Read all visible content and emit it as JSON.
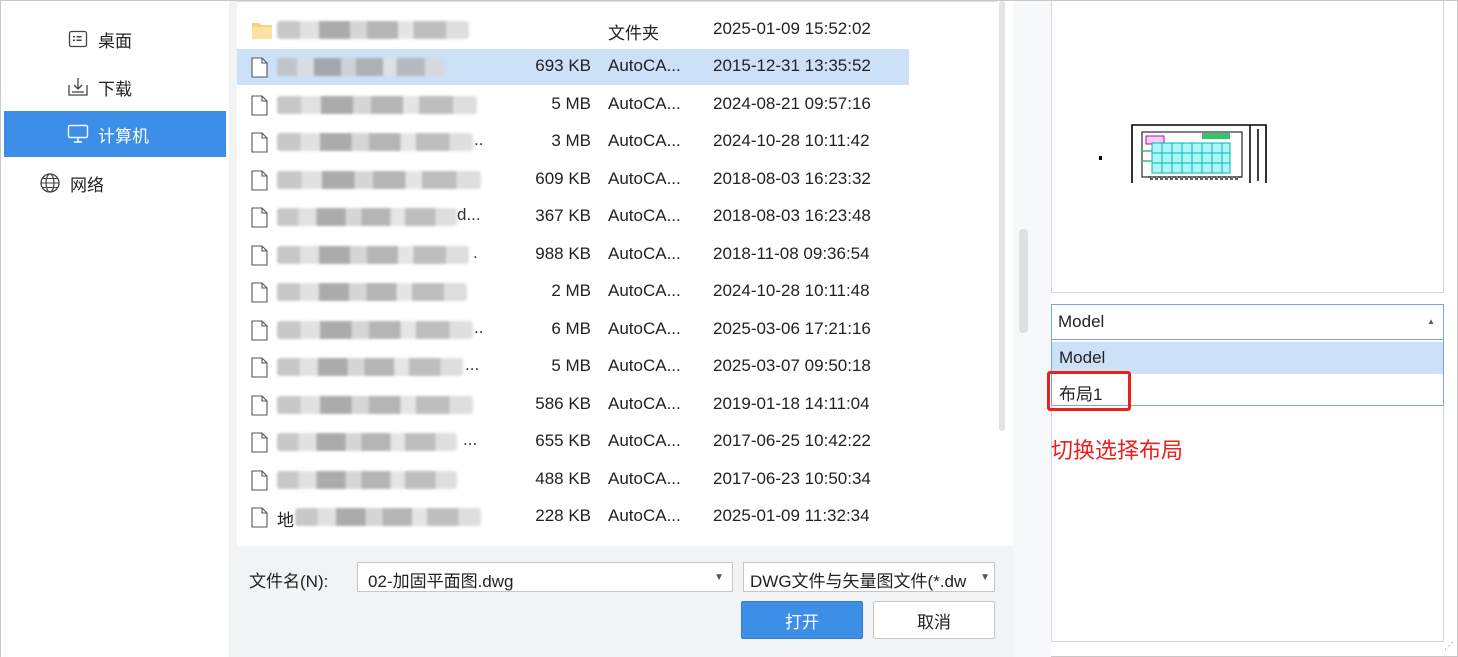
{
  "sidebar": {
    "items": [
      {
        "label": "桌面",
        "icon": "desktop-icon",
        "selected": false
      },
      {
        "label": "下载",
        "icon": "download-icon",
        "selected": false
      },
      {
        "label": "计算机",
        "icon": "computer-icon",
        "selected": true
      },
      {
        "label": "网络",
        "icon": "network-icon",
        "selected": false
      }
    ]
  },
  "files": [
    {
      "name_prefix": "",
      "ellipsis": "",
      "size": "",
      "type": "文件夹",
      "date": "2025-01-09 15:52:02",
      "icon": "folder-icon",
      "selected": false
    },
    {
      "name_prefix": "",
      "ellipsis": "",
      "size": "693 KB",
      "type": "AutoCA...",
      "date": "2015-12-31 13:35:52",
      "icon": "file-icon",
      "selected": true
    },
    {
      "name_prefix": "",
      "ellipsis": "",
      "size": "5 MB",
      "type": "AutoCA...",
      "date": "2024-08-21 09:57:16",
      "icon": "file-icon",
      "selected": false
    },
    {
      "name_prefix": "",
      "ellipsis": "..",
      "size": "3 MB",
      "type": "AutoCA...",
      "date": "2024-10-28 10:11:42",
      "icon": "file-icon",
      "selected": false
    },
    {
      "name_prefix": "",
      "ellipsis": "",
      "size": "609 KB",
      "type": "AutoCA...",
      "date": "2018-08-03 16:23:32",
      "icon": "file-icon",
      "selected": false
    },
    {
      "name_prefix": "",
      "ellipsis": "d...",
      "size": "367 KB",
      "type": "AutoCA...",
      "date": "2018-08-03 16:23:48",
      "icon": "file-icon",
      "selected": false
    },
    {
      "name_prefix": "",
      "ellipsis": ".",
      "size": "988 KB",
      "type": "AutoCA...",
      "date": "2018-11-08 09:36:54",
      "icon": "file-icon",
      "selected": false
    },
    {
      "name_prefix": "",
      "ellipsis": "",
      "size": "2 MB",
      "type": "AutoCA...",
      "date": "2024-10-28 10:11:48",
      "icon": "file-icon",
      "selected": false
    },
    {
      "name_prefix": "",
      "ellipsis": "..",
      "size": "6 MB",
      "type": "AutoCA...",
      "date": "2025-03-06 17:21:16",
      "icon": "file-icon",
      "selected": false
    },
    {
      "name_prefix": "",
      "ellipsis": "...",
      "size": "5 MB",
      "type": "AutoCA...",
      "date": "2025-03-07 09:50:18",
      "icon": "file-icon",
      "selected": false
    },
    {
      "name_prefix": "",
      "ellipsis": "",
      "size": "586 KB",
      "type": "AutoCA...",
      "date": "2019-01-18 14:11:04",
      "icon": "file-icon",
      "selected": false
    },
    {
      "name_prefix": "",
      "ellipsis": "...",
      "size": "655 KB",
      "type": "AutoCA...",
      "date": "2017-06-25 10:42:22",
      "icon": "file-icon",
      "selected": false
    },
    {
      "name_prefix": "",
      "ellipsis": "",
      "size": "488 KB",
      "type": "AutoCA...",
      "date": "2017-06-23 10:50:34",
      "icon": "file-icon",
      "selected": false
    },
    {
      "name_prefix": "地",
      "ellipsis": "",
      "size": "228 KB",
      "type": "AutoCA...",
      "date": "2025-01-09 11:32:34",
      "icon": "file-icon",
      "selected": false
    }
  ],
  "footer": {
    "filename_label": "文件名(N):",
    "filename_value": "02-加固平面图.dwg",
    "filetype_value": "DWG文件与矢量图文件(*.dw",
    "open_label": "打开",
    "cancel_label": "取消"
  },
  "preview": {
    "layout_selected": "Model",
    "layout_options": [
      "Model",
      "布局1"
    ],
    "annotation": "切换选择布局"
  },
  "colors": {
    "accent": "#3d8ee6",
    "selection": "#cce0f8",
    "annotation_red": "#e8211d"
  }
}
